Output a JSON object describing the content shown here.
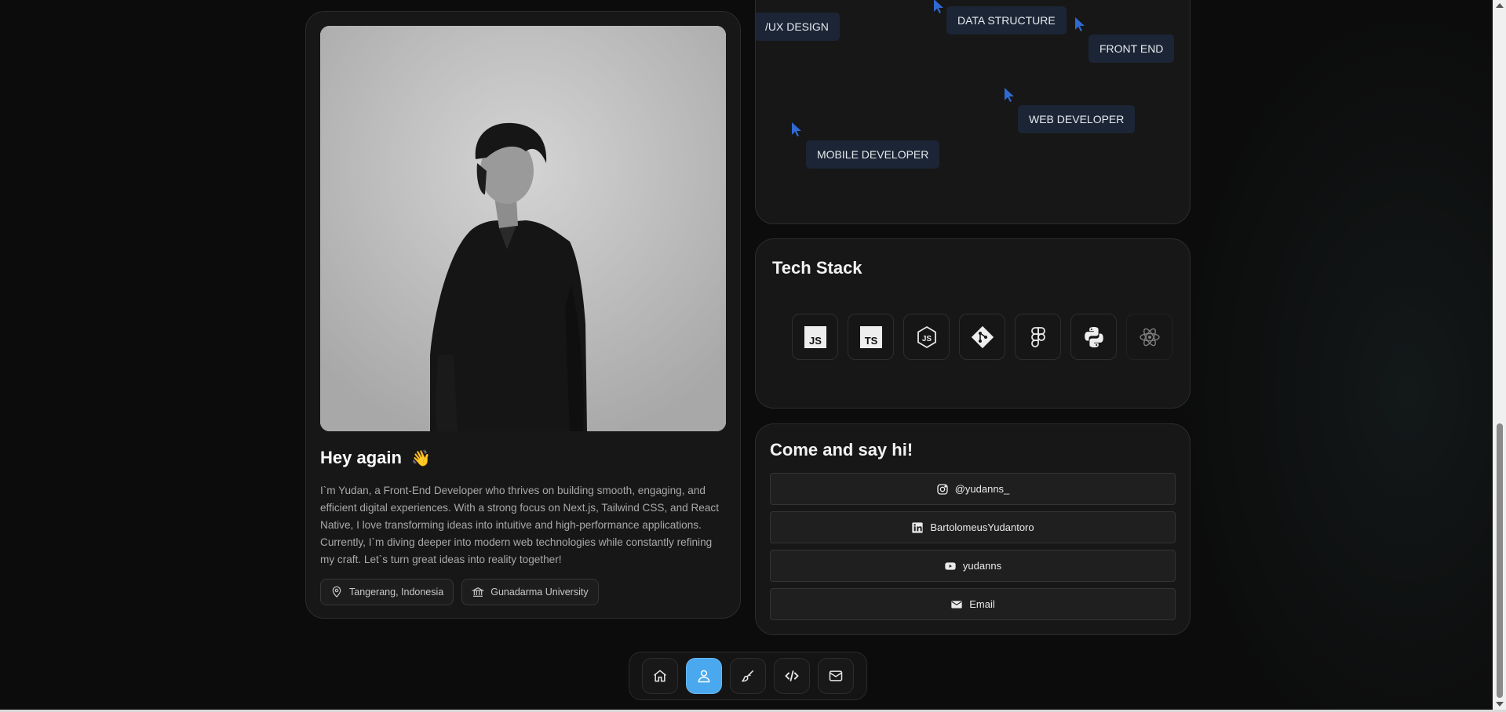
{
  "profile": {
    "greeting": "Hey again",
    "wave_emoji": "👋",
    "bio": "I`m Yudan, a Front-End Developer who thrives on building smooth, engaging, and efficient digital experiences. With a strong focus on Next.js, Tailwind CSS, and React Native, I love transforming ideas into intuitive and high-performance applications. Currently, I`m diving deeper into modern web technologies while constantly refining my craft. Let`s turn great ideas into reality together!",
    "location": "Tangerang, Indonesia",
    "university": "Gunadarma University",
    "photo_icon": "portrait-photo"
  },
  "skills": {
    "tags": [
      "/UX DESIGN",
      "DATA STRUCTURE",
      "FRONT END",
      "WEB DEVELOPER",
      "MOBILE DEVELOPER"
    ],
    "cursor_color": "#2f6ad0",
    "tag_color": "#1b2535"
  },
  "tech_stack": {
    "title": "Tech Stack",
    "items": [
      {
        "name": "javascript-icon"
      },
      {
        "name": "typescript-icon"
      },
      {
        "name": "nodejs-icon"
      },
      {
        "name": "git-icon"
      },
      {
        "name": "figma-icon"
      },
      {
        "name": "python-icon"
      },
      {
        "name": "react-icon"
      }
    ]
  },
  "contact": {
    "title": "Come and say hi!",
    "links": [
      {
        "icon": "instagram-icon",
        "label": "@yudanns_"
      },
      {
        "icon": "linkedin-icon",
        "label": "BartolomeusYudantoro"
      },
      {
        "icon": "youtube-icon",
        "label": "yudanns"
      },
      {
        "icon": "mail-icon",
        "label": "Email"
      }
    ]
  },
  "dock": {
    "items": [
      "home-icon",
      "user-icon",
      "brush-icon",
      "code-icon",
      "mail-icon"
    ],
    "active_index": 1,
    "active_color": "#4aa8ef"
  }
}
